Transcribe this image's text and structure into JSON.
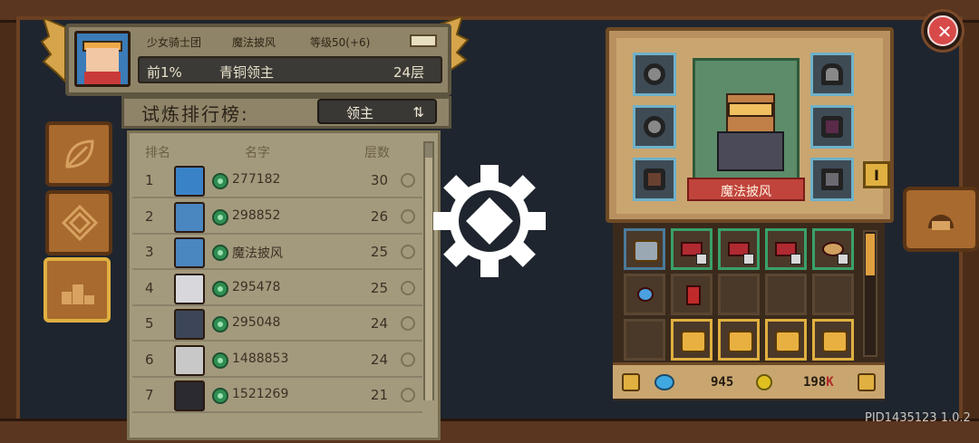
{
  "header": {
    "guild": "少女骑士团",
    "item_name": "魔法披风",
    "level": "等级50(+6)",
    "percentile": "前1%",
    "title": "青铜领主",
    "floor": "24层"
  },
  "ranking": {
    "title": "试炼排行榜:",
    "filter_label": "领主",
    "columns": {
      "rank": "排名",
      "name": "名字",
      "floors": "层数"
    },
    "rows": [
      {
        "rank": "1",
        "name": "277182",
        "floors": "30",
        "avatar_color": "#3a82c8"
      },
      {
        "rank": "2",
        "name": "298852",
        "floors": "26",
        "avatar_color": "#4a86c0"
      },
      {
        "rank": "3",
        "name": "魔法披风",
        "floors": "25",
        "avatar_color": "#4a86c0"
      },
      {
        "rank": "4",
        "name": "295478",
        "floors": "25",
        "avatar_color": "#d8d8dc"
      },
      {
        "rank": "5",
        "name": "295048",
        "floors": "24",
        "avatar_color": "#3c4658"
      },
      {
        "rank": "6",
        "name": "1488853",
        "floors": "24",
        "avatar_color": "#c8c8c8"
      },
      {
        "rank": "7",
        "name": "1521269",
        "floors": "21",
        "avatar_color": "#2a2a30"
      }
    ]
  },
  "equipment": {
    "character_name": "魔法披风",
    "tier_badge": "I"
  },
  "currency": {
    "gems": "945",
    "gold": "198",
    "gold_suffix": "K"
  },
  "footer": {
    "build": "PID1435123 1.0.2"
  },
  "icons": [
    "leaf-icon",
    "diamond-icon",
    "podium-icon",
    "gear-loading-icon",
    "close-icon",
    "helmet-icon",
    "swap-icon",
    "key-icon"
  ]
}
